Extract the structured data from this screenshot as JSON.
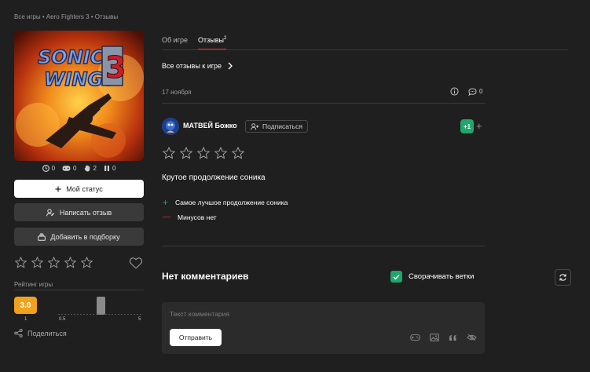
{
  "breadcrumb": "Все игры • Aero Fighters 3 • Отзывы",
  "game": {
    "stats": [
      {
        "icon": "clock-icon",
        "value": "0"
      },
      {
        "icon": "gamepad-icon",
        "value": "0"
      },
      {
        "icon": "hand-icon",
        "value": "2"
      },
      {
        "icon": "pause-icon",
        "value": "0"
      }
    ],
    "my_status_label": "Мой статус",
    "write_review_label": "Написать отзыв",
    "add_collection_label": "Добавить в подборку",
    "rating_label": "Рейтинг игры",
    "rating_value": "3.0",
    "rating_min": "1",
    "slider_left_tick": "0.5",
    "slider_right_tick": "5",
    "slider_level_fraction": 0.5,
    "share_label": "Поделиться"
  },
  "tabs": [
    {
      "label": "Об игре",
      "active": false
    },
    {
      "label": "Отзывы",
      "count": "2",
      "active": true
    }
  ],
  "reviews": {
    "all_reviews_label": "Все отзывы к игре",
    "date": "17 ноября",
    "comment_count": "0",
    "author": "МАТВЕЙ Божко",
    "subscribe_label": "Подписаться",
    "plus_one": "+1",
    "plus_sign": "+",
    "title": "Крутое продолжение соника",
    "pro_sign": "+",
    "pro": "Самое лучшое продолжение соника",
    "con_sign": "—",
    "con": "Минусов нет"
  },
  "comments": {
    "heading": "Нет комментариев",
    "collapse_label": "Сворачивать ветки",
    "placeholder": "Текст комментария",
    "send_label": "Отправить"
  },
  "colors": {
    "accent_red": "#d7343a",
    "green": "#1fa66c",
    "rating_orange": "#f0a21c",
    "background": "#1f1f1f"
  }
}
